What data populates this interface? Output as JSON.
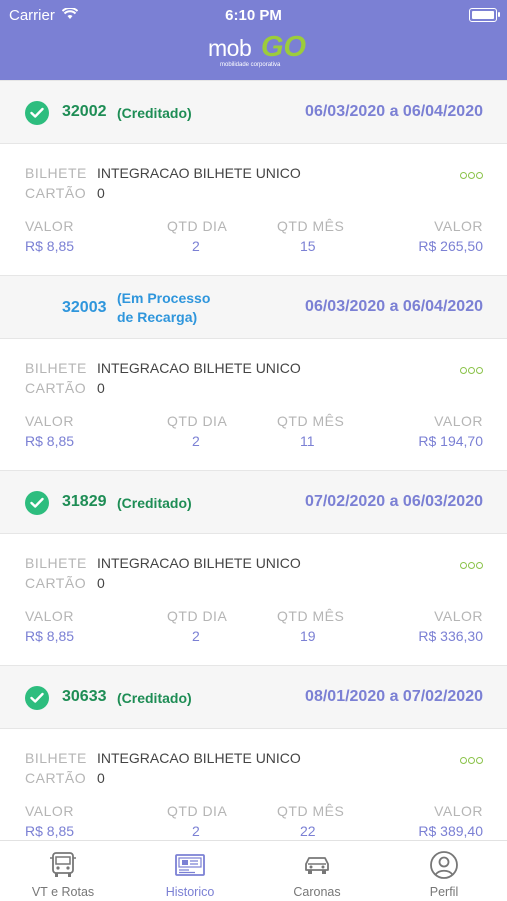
{
  "status_bar": {
    "carrier": "Carrier",
    "time": "6:10 PM"
  },
  "header": {
    "logo_text_1": "mob",
    "logo_text_2": "GO",
    "logo_tagline": "mobilidade corporativa"
  },
  "labels": {
    "bilhete": "BILHETE",
    "cartao": "CARTÃO",
    "valor": "VALOR",
    "qtd_dia": "QTD DIA",
    "qtd_mes": "QTD MÊS",
    "valor_total": "VALOR"
  },
  "records": [
    {
      "id": "32002",
      "status": "(Creditado)",
      "dates": "06/03/2020 a 06/04/2020",
      "bilhete": "INTEGRACAO BILHETE UNICO",
      "cartao": "0",
      "valor": "R$ 8,85",
      "qtd_dia": "2",
      "qtd_mes": "15",
      "valor_total": "R$ 265,50"
    },
    {
      "id": "32003",
      "status_line1": "(Em Processo",
      "status_line2": "de Recarga)",
      "dates": "06/03/2020 a 06/04/2020",
      "bilhete": "INTEGRACAO BILHETE UNICO",
      "cartao": "0",
      "valor": "R$ 8,85",
      "qtd_dia": "2",
      "qtd_mes": "11",
      "valor_total": "R$ 194,70"
    },
    {
      "id": "31829",
      "status": "(Creditado)",
      "dates": "07/02/2020 a 06/03/2020",
      "bilhete": "INTEGRACAO BILHETE UNICO",
      "cartao": "0",
      "valor": "R$ 8,85",
      "qtd_dia": "2",
      "qtd_mes": "19",
      "valor_total": "R$ 336,30"
    },
    {
      "id": "30633",
      "status": "(Creditado)",
      "dates": "08/01/2020 a 07/02/2020",
      "bilhete": "INTEGRACAO BILHETE UNICO",
      "cartao": "0",
      "valor": "R$ 8,85",
      "qtd_dia": "2",
      "qtd_mes": "22",
      "valor_total": "R$ 389,40"
    }
  ],
  "tabs": [
    {
      "label": "VT e Rotas",
      "icon": "bus-icon",
      "active": false
    },
    {
      "label": "Historico",
      "icon": "ticket-icon",
      "active": true
    },
    {
      "label": "Caronas",
      "icon": "car-icon",
      "active": false
    },
    {
      "label": "Perfil",
      "icon": "user-icon",
      "active": false
    }
  ],
  "colors": {
    "header": "#7b80d4",
    "accent": "#7b80d4",
    "credited": "#1e8d55",
    "processing": "#2f96dc",
    "check": "#2dbd7e",
    "dots": "#8bc34a"
  }
}
